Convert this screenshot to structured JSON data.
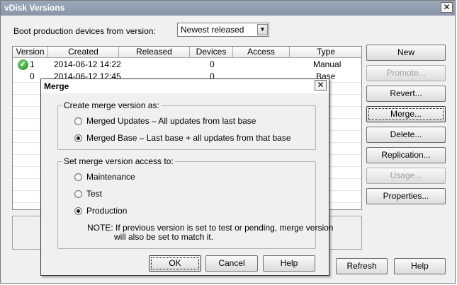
{
  "window": {
    "title": "vDisk Versions",
    "close_glyph": "✕"
  },
  "boot": {
    "label": "Boot production devices from version:",
    "selected": "Newest released"
  },
  "table": {
    "columns": [
      "Version",
      "Created",
      "Released",
      "Devices",
      "Access",
      "Type"
    ],
    "rows": [
      {
        "version": "1",
        "created": "2014-06-12 14:22",
        "released": "",
        "devices": "0",
        "access": "",
        "type": "Manual",
        "icon": "check-icon"
      },
      {
        "version": "0",
        "created": "2014-06-12 12:45",
        "released": "",
        "devices": "0",
        "access": "",
        "type": "Base"
      }
    ]
  },
  "side_buttons": {
    "new": "New",
    "promote": "Promote...",
    "revert": "Revert...",
    "merge": "Merge...",
    "delete": "Delete...",
    "replication": "Replication...",
    "usage": "Usage...",
    "properties": "Properties..."
  },
  "bottom_buttons": {
    "refresh": "Refresh",
    "help": "Help"
  },
  "dialog": {
    "title": "Merge",
    "close_glyph": "✕",
    "create_group": {
      "title": "Create merge version as:",
      "options": [
        "Merged Updates – All updates from last base",
        "Merged Base – Last base + all updates from that base"
      ],
      "selected_index": 1
    },
    "access_group": {
      "title": "Set merge version access to:",
      "options": [
        "Maintenance",
        "Test",
        "Production"
      ],
      "selected_index": 2,
      "note_line1": "NOTE:  If previous version is set to test or pending, merge version",
      "note_line2": "will also be set to match it."
    },
    "buttons": {
      "ok": "OK",
      "cancel": "Cancel",
      "help": "Help"
    }
  }
}
